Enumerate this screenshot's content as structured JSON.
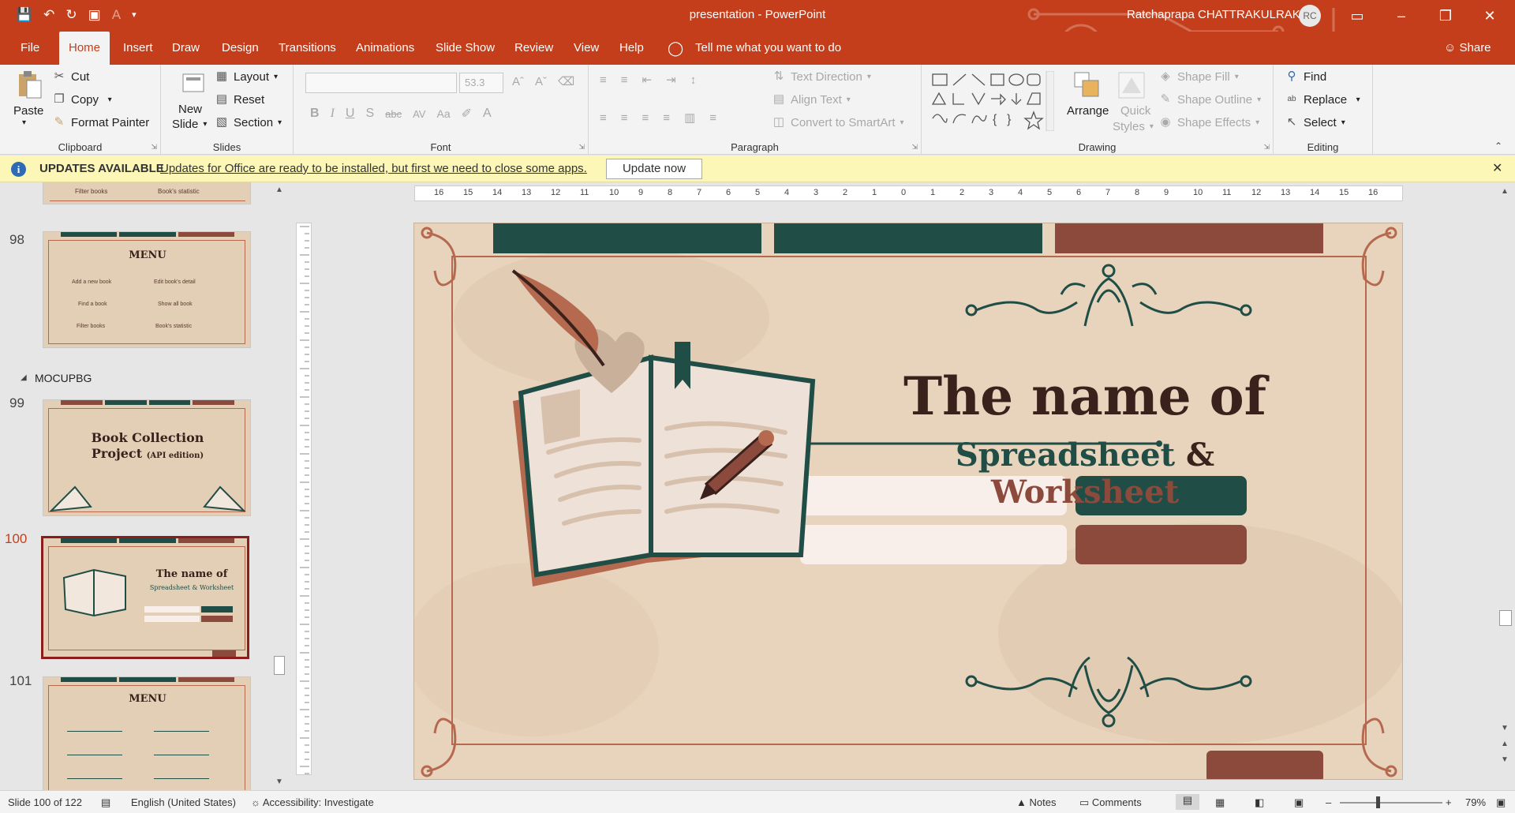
{
  "titlebar": {
    "doc_title": "presentation  -  PowerPoint",
    "user_name": "Ratchaprapa CHATTRAKULRAK",
    "avatar_initials": "RC"
  },
  "tabs": {
    "file": "File",
    "home": "Home",
    "insert": "Insert",
    "draw": "Draw",
    "design": "Design",
    "transitions": "Transitions",
    "animations": "Animations",
    "slideshow": "Slide Show",
    "review": "Review",
    "view": "View",
    "help": "Help",
    "tell_me": "Tell me what you want to do",
    "share": "Share"
  },
  "ribbon": {
    "clipboard": {
      "label": "Clipboard",
      "paste": "Paste",
      "cut": "Cut",
      "copy": "Copy",
      "format_painter": "Format Painter"
    },
    "slides": {
      "label": "Slides",
      "new_slide_line1": "New",
      "new_slide_line2": "Slide",
      "layout": "Layout",
      "reset": "Reset",
      "section": "Section"
    },
    "font": {
      "label": "Font",
      "font_size": "53.3"
    },
    "paragraph": {
      "label": "Paragraph",
      "text_direction": "Text Direction",
      "align_text": "Align Text",
      "convert_smartart": "Convert to SmartArt"
    },
    "drawing": {
      "label": "Drawing",
      "arrange": "Arrange",
      "quick_styles_1": "Quick",
      "quick_styles_2": "Styles",
      "shape_fill": "Shape Fill",
      "shape_outline": "Shape Outline",
      "shape_effects": "Shape Effects"
    },
    "editing": {
      "label": "Editing",
      "find": "Find",
      "replace": "Replace",
      "select": "Select"
    }
  },
  "notification": {
    "title": "UPDATES AVAILABLE",
    "message": "Updates for Office are ready to be installed, but first we need to close some apps.",
    "button": "Update now"
  },
  "thumbnails": {
    "section_name": "MOCUPBG",
    "slides": [
      {
        "num": "98",
        "title": "MENU",
        "items": [
          "Add a new book",
          "Edit book's detail",
          "Find a book",
          "Show all book",
          "Filter books",
          "Book's statistic"
        ]
      },
      {
        "num": "99",
        "title_line1": "Book Collection",
        "title_line2": "Project",
        "title_small": "(API edition)"
      },
      {
        "num": "100",
        "title": "The name of",
        "subtitle": "Spreadsheet & Worksheet"
      },
      {
        "num": "101",
        "title": "MENU"
      }
    ],
    "partial_labels": [
      "Filter books",
      "Book's statistic"
    ]
  },
  "slide": {
    "title": "The name of",
    "subtitle_a": "Spreadsheet",
    "subtitle_b": " & ",
    "subtitle_c": "Worksheet"
  },
  "ruler_ticks": [
    "16",
    "15",
    "14",
    "13",
    "12",
    "11",
    "10",
    "9",
    "8",
    "7",
    "6",
    "5",
    "4",
    "3",
    "2",
    "1",
    "0",
    "1",
    "2",
    "3",
    "4",
    "5",
    "6",
    "7",
    "8",
    "9",
    "10",
    "11",
    "12",
    "13",
    "14",
    "15",
    "16"
  ],
  "status": {
    "slide_info": "Slide 100 of 122",
    "language": "English (United States)",
    "accessibility": "Accessibility: Investigate",
    "notes": "Notes",
    "comments": "Comments",
    "zoom": "79%"
  },
  "colors": {
    "accent": "#c43e1c",
    "teal": "#204e46",
    "brown": "#8b4a3c",
    "parchment": "#e8d4bd"
  }
}
